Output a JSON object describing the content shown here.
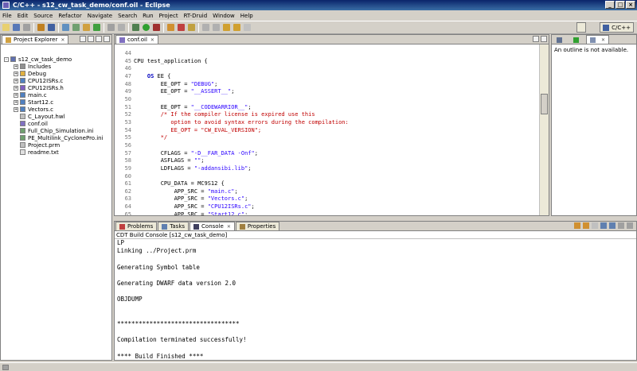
{
  "window": {
    "title": "C/C++ - s12_cw_task_demo/conf.oil - Eclipse"
  },
  "menu": [
    "File",
    "Edit",
    "Source",
    "Refactor",
    "Navigate",
    "Search",
    "Run",
    "Project",
    "RT-Druid",
    "Window",
    "Help"
  ],
  "perspective": {
    "label": "C/C++"
  },
  "explorer": {
    "tab": "Project Explorer",
    "tree": [
      {
        "label": "s12_cw_task_demo",
        "level": 0,
        "twisty": "-",
        "icon": "project-icon"
      },
      {
        "label": "Includes",
        "level": 1,
        "twisty": "+",
        "icon": "includes-icon"
      },
      {
        "label": "Debug",
        "level": 1,
        "twisty": "+",
        "icon": "folder-icon"
      },
      {
        "label": "CPU12ISRs.c",
        "level": 1,
        "twisty": "+",
        "icon": "c-file-icon"
      },
      {
        "label": "CPU12ISRs.h",
        "level": 1,
        "twisty": "+",
        "icon": "h-file-icon"
      },
      {
        "label": "main.c",
        "level": 1,
        "twisty": "+",
        "icon": "c-file-icon"
      },
      {
        "label": "Start12.c",
        "level": 1,
        "twisty": "+",
        "icon": "c-file-icon"
      },
      {
        "label": "Vectors.c",
        "level": 1,
        "twisty": "+",
        "icon": "c-file-icon"
      },
      {
        "label": "C_Layout.hwl",
        "level": 1,
        "twisty": "",
        "icon": "file-icon"
      },
      {
        "label": "conf.oil",
        "level": 1,
        "twisty": "",
        "icon": "oil-file-icon"
      },
      {
        "label": "Full_Chip_Simulation.ini",
        "level": 1,
        "twisty": "",
        "icon": "ini-file-icon"
      },
      {
        "label": "PE_Multilink_CyclonePro.ini",
        "level": 1,
        "twisty": "",
        "icon": "ini-file-icon"
      },
      {
        "label": "Project.prm",
        "level": 1,
        "twisty": "",
        "icon": "file-icon"
      },
      {
        "label": "readme.txt",
        "level": 1,
        "twisty": "",
        "icon": "text-file-icon"
      }
    ]
  },
  "editor": {
    "tab": "conf.oil",
    "lines": [
      {
        "n": "44",
        "parts": []
      },
      {
        "n": "45",
        "parts": [
          {
            "t": "CPU test_application {",
            "c": "ct"
          }
        ]
      },
      {
        "n": "46",
        "parts": []
      },
      {
        "n": "47",
        "parts": [
          {
            "t": "    ",
            "c": "ct"
          },
          {
            "t": "OS",
            "c": "os"
          },
          {
            "t": " EE {",
            "c": "ct"
          }
        ]
      },
      {
        "n": "48",
        "parts": [
          {
            "t": "        EE_OPT = ",
            "c": "ct"
          },
          {
            "t": "\"DEBUG\"",
            "c": "str"
          },
          {
            "t": ";",
            "c": "ct"
          }
        ]
      },
      {
        "n": "49",
        "parts": [
          {
            "t": "        EE_OPT = ",
            "c": "ct"
          },
          {
            "t": "\"__ASSERT__\"",
            "c": "str"
          },
          {
            "t": ";",
            "c": "ct"
          }
        ]
      },
      {
        "n": "50",
        "parts": []
      },
      {
        "n": "51",
        "parts": [
          {
            "t": "        EE_OPT = ",
            "c": "ct"
          },
          {
            "t": "\"__CODEWARRIOR__\"",
            "c": "str"
          },
          {
            "t": ";",
            "c": "ct"
          }
        ]
      },
      {
        "n": "52",
        "parts": [
          {
            "t": "        /* If the compiler license is expired use this",
            "c": "cm"
          }
        ]
      },
      {
        "n": "53",
        "parts": [
          {
            "t": "           option to avoid syntax errors during the compilation:",
            "c": "cm"
          }
        ]
      },
      {
        "n": "54",
        "parts": [
          {
            "t": "           EE_OPT = \"CW_EVAL_VERSION\";",
            "c": "cm"
          }
        ]
      },
      {
        "n": "55",
        "parts": [
          {
            "t": "        */",
            "c": "cm"
          }
        ]
      },
      {
        "n": "56",
        "parts": []
      },
      {
        "n": "57",
        "parts": [
          {
            "t": "        CFLAGS = ",
            "c": "ct"
          },
          {
            "t": "\"-D__FAR_DATA -Onf\"",
            "c": "str"
          },
          {
            "t": ";",
            "c": "ct"
          }
        ]
      },
      {
        "n": "58",
        "parts": [
          {
            "t": "        ASFLAGS = ",
            "c": "ct"
          },
          {
            "t": "\"\"",
            "c": "str"
          },
          {
            "t": ";",
            "c": "ct"
          }
        ]
      },
      {
        "n": "59",
        "parts": [
          {
            "t": "        LDFLAGS = ",
            "c": "ct"
          },
          {
            "t": "\"-addansibi.lib\"",
            "c": "str"
          },
          {
            "t": ";",
            "c": "ct"
          }
        ]
      },
      {
        "n": "60",
        "parts": []
      },
      {
        "n": "61",
        "parts": [
          {
            "t": "        CPU_DATA = MC9S12 {",
            "c": "ct"
          }
        ]
      },
      {
        "n": "62",
        "parts": [
          {
            "t": "            APP_SRC = ",
            "c": "ct"
          },
          {
            "t": "\"main.c\"",
            "c": "str"
          },
          {
            "t": ";",
            "c": "ct"
          }
        ]
      },
      {
        "n": "63",
        "parts": [
          {
            "t": "            APP_SRC = ",
            "c": "ct"
          },
          {
            "t": "\"Vectors.c\"",
            "c": "str"
          },
          {
            "t": ";",
            "c": "ct"
          }
        ]
      },
      {
        "n": "64",
        "parts": [
          {
            "t": "            APP_SRC = ",
            "c": "ct"
          },
          {
            "t": "\"CPU12ISRs.c\"",
            "c": "str"
          },
          {
            "t": ";",
            "c": "ct"
          }
        ]
      },
      {
        "n": "65",
        "parts": [
          {
            "t": "            APP_SRC = ",
            "c": "ct"
          },
          {
            "t": "\"Start12.c\"",
            "c": "str"
          },
          {
            "t": ";",
            "c": "ct"
          }
        ]
      }
    ]
  },
  "outline": {
    "message": "An outline is not available."
  },
  "bottom_tabs": [
    {
      "label": "Problems",
      "icon": "problems-icon"
    },
    {
      "label": "Tasks",
      "icon": "tasks-icon"
    },
    {
      "label": "Console",
      "icon": "console-icon"
    },
    {
      "label": "Properties",
      "icon": "properties-icon"
    }
  ],
  "console": {
    "title": "CDT Build Console [s12_cw_task_demo]",
    "lines": [
      "LP",
      "Linking ../Project.prm",
      "",
      "Generating Symbol table",
      "",
      "Generating DWARF data version 2.0",
      "",
      "OBJDUMP",
      "",
      "",
      "**********************************",
      "",
      "Compilation terminated successfully!",
      "",
      "**** Build Finished ****"
    ]
  },
  "colors": {
    "keyword": "#7f0055",
    "string": "#2a00ff",
    "comment": "#c00000",
    "title_bar": "#0a246a"
  }
}
